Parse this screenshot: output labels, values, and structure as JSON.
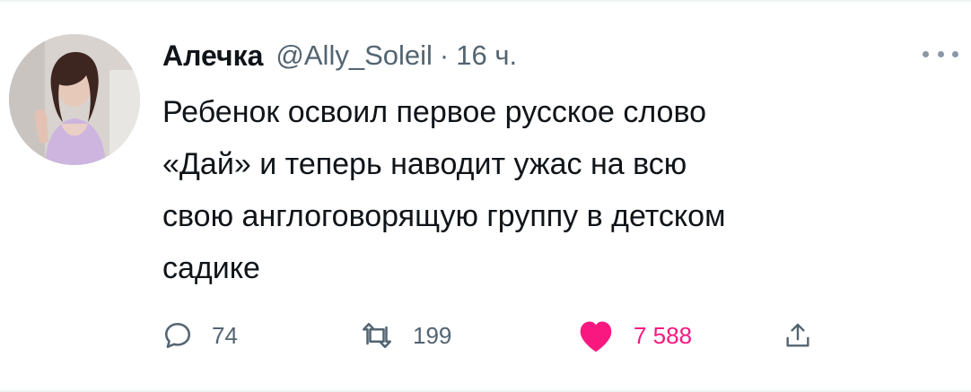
{
  "tweet": {
    "author_name": "Алечка",
    "handle": "@Ally_Soleil",
    "separator": "·",
    "time_ago": "16 ч.",
    "text_lines": [
      "Ребенок освоил первое русское слово",
      "«Дай» и теперь наводит ужас на всю",
      "свою англоговорящую группу в детском",
      "садике"
    ]
  },
  "actions": {
    "reply_icon": "comment-icon",
    "reply_count": "74",
    "retweet_icon": "retweet-icon",
    "retweet_count": "199",
    "like_icon": "heart-icon",
    "like_count": "7 588",
    "share_icon": "share-icon"
  },
  "colors": {
    "text": "#0f1419",
    "secondary": "#536471",
    "like_active": "#f91880",
    "divider": "#eff3f4"
  }
}
